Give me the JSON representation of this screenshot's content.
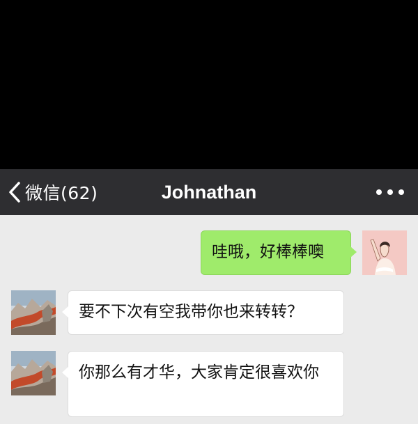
{
  "nav": {
    "back_label": "微信(62)",
    "title": "Johnathan",
    "back_icon": "chevron-left-icon",
    "more_icon": "more-dots-icon"
  },
  "messages": [
    {
      "sender": "me",
      "text": "哇哦，好棒棒噢"
    },
    {
      "sender": "other",
      "text": "要不下次有空我带你也来转转？"
    },
    {
      "sender": "other",
      "text": "你那么有才华，大家肯定很喜欢你"
    }
  ],
  "colors": {
    "nav_background": "#2e2e31",
    "chat_background": "#ebebeb",
    "my_bubble": "#9feb6b",
    "their_bubble": "#ffffff"
  }
}
